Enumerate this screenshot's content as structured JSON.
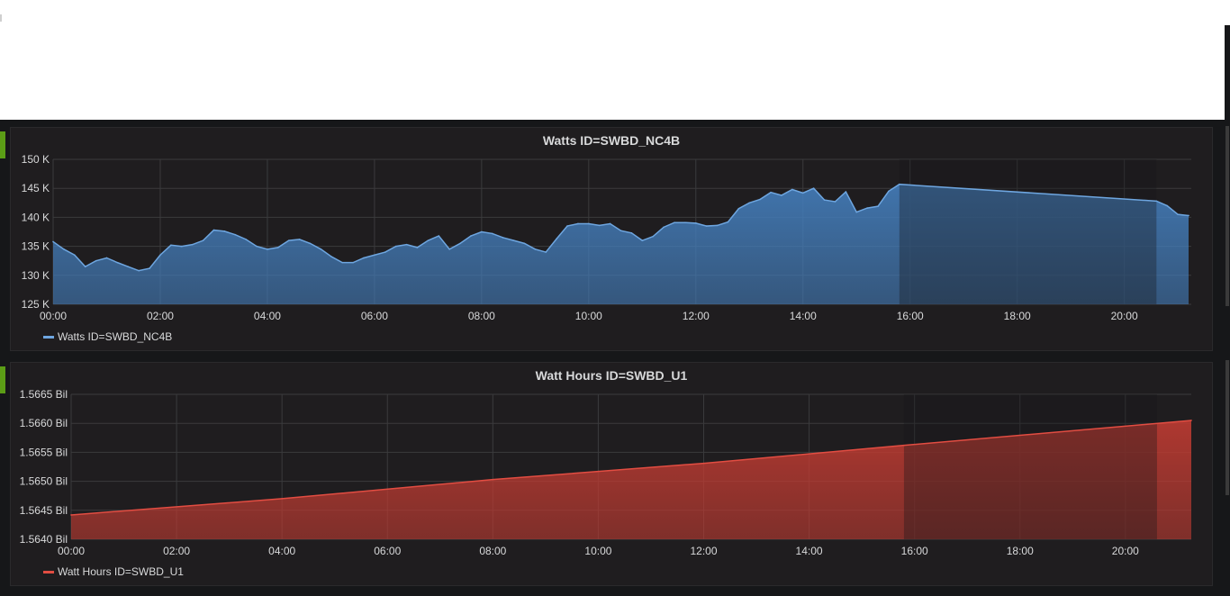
{
  "colors": {
    "background": "#161719",
    "panel": "#1f1d1f",
    "grid": "#3b3b3d",
    "watts": "#6ea6e0",
    "watts_fill": "#447ebc",
    "watthours": "#e24d42",
    "watthours_fill": "#bf3b32"
  },
  "chart_data": [
    {
      "type": "area",
      "title": "Watts ID=SWBD_NC4B",
      "xlabel": "",
      "ylabel": "",
      "x_ticks": [
        "00:00",
        "02:00",
        "04:00",
        "06:00",
        "08:00",
        "10:00",
        "12:00",
        "14:00",
        "16:00",
        "18:00",
        "20:00"
      ],
      "y_ticks": [
        "125 K",
        "130 K",
        "135 K",
        "140 K",
        "145 K",
        "150 K"
      ],
      "x_range_hours": [
        0,
        21.25
      ],
      "ylim": [
        125000,
        150000
      ],
      "grid": true,
      "legend_position": "bottom-left",
      "series": [
        {
          "name": "Watts ID=SWBD_NC4B",
          "color": "#6ea6e0",
          "x_hours": [
            0.0,
            0.2,
            0.4,
            0.6,
            0.8,
            1.0,
            1.2,
            1.4,
            1.6,
            1.8,
            2.0,
            2.2,
            2.4,
            2.6,
            2.8,
            3.0,
            3.2,
            3.4,
            3.6,
            3.8,
            4.0,
            4.2,
            4.4,
            4.6,
            4.8,
            5.0,
            5.2,
            5.4,
            5.6,
            5.8,
            6.0,
            6.2,
            6.4,
            6.6,
            6.8,
            7.0,
            7.2,
            7.4,
            7.6,
            7.8,
            8.0,
            8.2,
            8.4,
            8.6,
            8.8,
            9.0,
            9.2,
            9.4,
            9.6,
            9.8,
            10.0,
            10.2,
            10.4,
            10.6,
            10.8,
            11.0,
            11.2,
            11.4,
            11.6,
            11.8,
            12.0,
            12.2,
            12.4,
            12.6,
            12.8,
            13.0,
            13.2,
            13.4,
            13.6,
            13.8,
            14.0,
            14.2,
            14.4,
            14.6,
            14.8,
            15.0,
            15.2,
            15.4,
            15.6,
            15.8,
            20.6,
            20.8,
            21.0,
            21.2
          ],
          "values": [
            135800,
            134500,
            133500,
            131500,
            132500,
            133000,
            132200,
            131500,
            130800,
            131200,
            133500,
            135200,
            135000,
            135300,
            136000,
            137800,
            137600,
            137000,
            136200,
            135000,
            134500,
            134800,
            136000,
            136200,
            135500,
            134500,
            133200,
            132200,
            132200,
            133000,
            133500,
            134000,
            135000,
            135300,
            134800,
            136000,
            136800,
            134500,
            135500,
            136800,
            137500,
            137200,
            136500,
            136000,
            135500,
            134500,
            134000,
            136300,
            138500,
            138900,
            138900,
            138600,
            138900,
            137700,
            137300,
            136000,
            136700,
            138300,
            139100,
            139100,
            139000,
            138500,
            138600,
            139200,
            141500,
            142500,
            143100,
            144300,
            143800,
            144800,
            144200,
            145000,
            143000,
            142700,
            144400,
            140900,
            141600,
            141900,
            144500,
            145700,
            142800,
            142000,
            140500,
            140300
          ]
        }
      ]
    },
    {
      "type": "area",
      "title": "Watt Hours ID=SWBD_U1",
      "xlabel": "",
      "ylabel": "",
      "x_ticks": [
        "00:00",
        "02:00",
        "04:00",
        "06:00",
        "08:00",
        "10:00",
        "12:00",
        "14:00",
        "16:00",
        "18:00",
        "20:00"
      ],
      "y_ticks": [
        "1.5640 Bil",
        "1.5645 Bil",
        "1.5650 Bil",
        "1.5655 Bil",
        "1.5660 Bil",
        "1.5665 Bil"
      ],
      "x_range_hours": [
        0,
        21.25
      ],
      "ylim": [
        1.564,
        1.5665
      ],
      "y_unit": "Bil",
      "grid": true,
      "legend_position": "bottom-left",
      "series": [
        {
          "name": "Watt Hours ID=SWBD_U1",
          "color": "#e24d42",
          "x_hours": [
            0.0,
            4.0,
            8.0,
            12.0,
            15.8,
            21.25
          ],
          "values": [
            1.56442,
            1.5647,
            1.56503,
            1.56531,
            1.56562,
            1.56605
          ]
        }
      ]
    }
  ]
}
